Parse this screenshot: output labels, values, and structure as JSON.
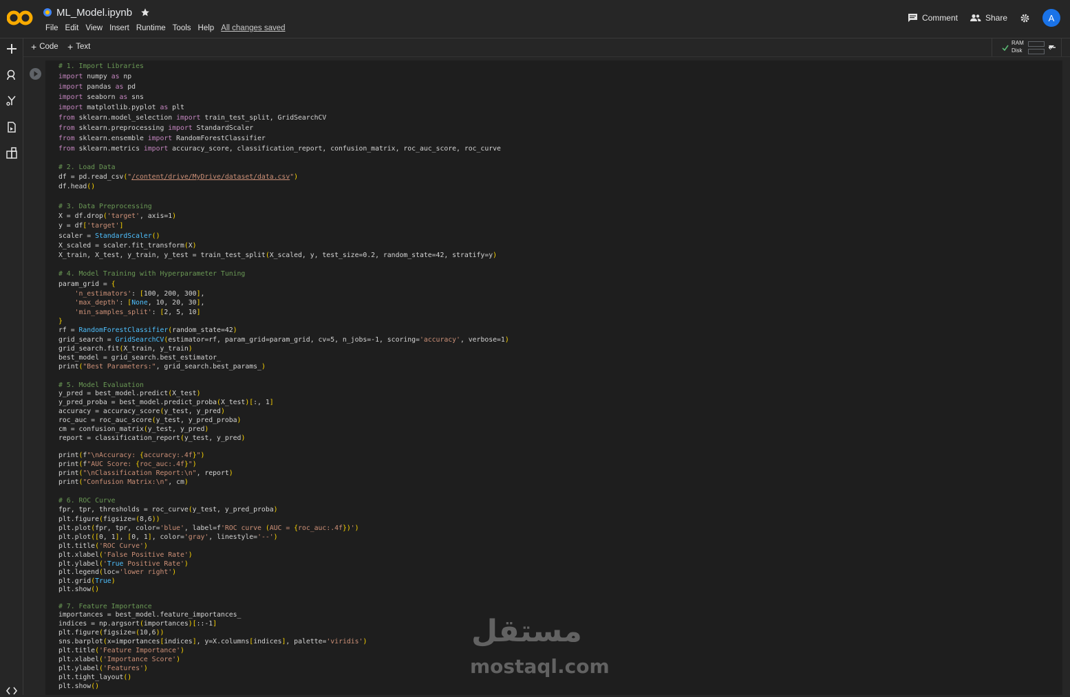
{
  "header": {
    "logo_text": "CO",
    "doc_title": "ML_Model.ipynb",
    "menu": [
      "File",
      "Edit",
      "View",
      "Insert",
      "Runtime",
      "Tools",
      "Help"
    ],
    "saved_status": "All changes saved",
    "comment_label": "Comment",
    "share_label": "Share",
    "avatar_initial": "A"
  },
  "toolbar": {
    "add_code_label": "Code",
    "add_text_label": "Text",
    "ram_label": "RAM",
    "disk_label": "Disk"
  },
  "watermark": {
    "arabic": "مستقل",
    "latin": "mostaql.com"
  },
  "code_lines": [
    "# 1. Import Libraries",
    "import numpy as np",
    "import pandas as pd",
    "import seaborn as sns",
    "import matplotlib.pyplot as plt",
    "from sklearn.model_selection import train_test_split, GridSearchCV",
    "from sklearn.preprocessing import StandardScaler",
    "from sklearn.ensemble import RandomForestClassifier",
    "from sklearn.metrics import accuracy_score, classification_report, confusion_matrix, roc_auc_score, roc_curve",
    "# 2. Load Data",
    "df = pd.read_csv(\"/content/drive/MyDrive/dataset/data.csv\")",
    "df.head()",
    "# 3. Data Preprocessing",
    "X = df.drop('target', axis=1)",
    "y = df['target']",
    "scaler = StandardScaler()",
    "X_scaled = scaler.fit_transform(X)",
    "X_train, X_test, y_train, y_test = train_test_split(X_scaled, y, test_size=0.2, random_state=42, stratify=y)",
    "# 4. Model Training with Hyperparameter Tuning",
    "param_grid = {",
    "    'n_estimators': [100, 200, 300],",
    "    'max_depth': [None, 10, 20, 30],",
    "    'min_samples_split': [2, 5, 10]",
    "}",
    "rf = RandomForestClassifier(random_state=42)",
    "grid_search = GridSearchCV(estimator=rf, param_grid=param_grid, cv=5, n_jobs=-1, scoring='accuracy', verbose=1)",
    "grid_search.fit(X_train, y_train)",
    "best_model = grid_search.best_estimator_",
    "print(\"Best Parameters:\", grid_search.best_params_)",
    "# 5. Model Evaluation",
    "y_pred = best_model.predict(X_test)",
    "y_pred_proba = best_model.predict_proba(X_test)[:, 1]",
    "accuracy = accuracy_score(y_test, y_pred)",
    "roc_auc = roc_auc_score(y_test, y_pred_proba)",
    "cm = confusion_matrix(y_test, y_pred)",
    "report = classification_report(y_test, y_pred)",
    "print(f\"\\nAccuracy: {accuracy:.4f}\")",
    "print(f\"AUC Score: {roc_auc:.4f}\")",
    "print(\"\\nClassification Report:\\n\", report)",
    "print(\"Confusion Matrix:\\n\", cm)",
    "# 6. ROC Curve",
    "fpr, tpr, thresholds = roc_curve(y_test, y_pred_proba)",
    "plt.figure(figsize=(8,6))",
    "plt.plot(fpr, tpr, color='blue', label=f'ROC curve (AUC = {roc_auc:.4f})')",
    "plt.plot([0, 1], [0, 1], color='gray', linestyle='--')",
    "plt.title('ROC Curve')",
    "plt.xlabel('False Positive Rate')",
    "plt.ylabel('True Positive Rate')",
    "plt.legend(loc='lower right')",
    "plt.grid(True)",
    "plt.show()",
    "# 7. Feature Importance",
    "importances = best_model.feature_importances_",
    "indices = np.argsort(importances)[::-1]",
    "plt.figure(figsize=(10,6))",
    "sns.barplot(x=importances[indices], y=X.columns[indices], palette='viridis')",
    "plt.title('Feature Importance')",
    "plt.xlabel('Importance Score')",
    "plt.ylabel('Features')",
    "plt.tight_layout()",
    "plt.show()"
  ]
}
